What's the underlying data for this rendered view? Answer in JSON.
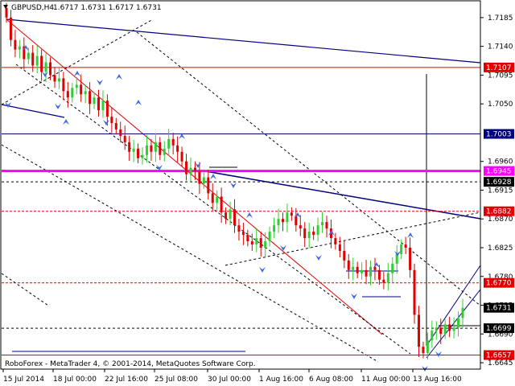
{
  "header": {
    "symbol": "GBPUSD,H4",
    "ohlc": "1.6717 1.6731 1.6717 1.6731"
  },
  "footer": {
    "copyright": "RoboForex - MetaTrader 4, © 2001-2014, MetaQuotes Software Corp."
  },
  "colors": {
    "bull": "#32cd32",
    "bear": "#e00000",
    "level_red": "#e00000",
    "level_blue": "#000080",
    "level_magenta": "#ff00ff",
    "arrow": "#4169e1",
    "grid_dark": "#000000",
    "label_red_bg": "#e00000",
    "label_blue_bg": "#000080",
    "label_magenta_bg": "#ff00ff",
    "label_current_bg": "#000000"
  },
  "chart_data": {
    "type": "candlestick",
    "title": "GBPUSD,H4",
    "x_tick_labels": [
      "15 Jul 2014",
      "18 Jul 00:00",
      "22 Jul 16:00",
      "25 Jul 08:00",
      "30 Jul 00:00",
      "1 Aug 16:00",
      "6 Aug 08:00",
      "11 Aug 00:00",
      "13 Aug 16:00"
    ],
    "y_tick_labels": [
      "1.7185",
      "1.7140",
      "1.7095",
      "1.7050",
      "1.6960",
      "1.6915",
      "1.6870",
      "1.6825",
      "1.6780",
      "1.6735",
      "1.6690",
      "1.6645"
    ],
    "ylim": [
      1.6635,
      1.721
    ],
    "price_labels": [
      {
        "value": "1.7107",
        "style": "red"
      },
      {
        "value": "1.7003",
        "style": "blue"
      },
      {
        "value": "1.6945",
        "style": "magenta"
      },
      {
        "value": "1.6928",
        "style": "black"
      },
      {
        "value": "1.6882",
        "style": "red"
      },
      {
        "value": "1.6770",
        "style": "red"
      },
      {
        "value": "1.6731",
        "style": "current"
      },
      {
        "value": "1.6699",
        "style": "black"
      },
      {
        "value": "1.6657",
        "style": "red"
      }
    ],
    "closes": [
      1.7185,
      1.715,
      1.7135,
      1.714,
      1.712,
      1.713,
      1.711,
      1.7125,
      1.71,
      1.7115,
      1.7095,
      1.7085,
      1.709,
      1.707,
      1.706,
      1.7075,
      1.708,
      1.7065,
      1.707,
      1.705,
      1.706,
      1.704,
      1.7055,
      1.703,
      1.702,
      1.701,
      1.7,
      1.699,
      1.6975,
      1.698,
      1.6965,
      1.697,
      1.6985,
      1.6975,
      1.699,
      1.697,
      1.698,
      1.6995,
      1.6985,
      1.6975,
      1.696,
      1.694,
      1.695,
      1.6945,
      1.6925,
      1.6935,
      1.691,
      1.6895,
      1.6905,
      1.688,
      1.687,
      1.6885,
      1.686,
      1.685,
      1.6845,
      1.6835,
      1.683,
      1.684,
      1.6825,
      1.6835,
      1.685,
      1.686,
      1.687,
      1.6865,
      1.688,
      1.6875,
      1.686,
      1.6855,
      1.684,
      1.685,
      1.6845,
      1.686,
      1.6865,
      1.6855,
      1.684,
      1.683,
      1.682,
      1.6805,
      1.679,
      1.6795,
      1.6785,
      1.679,
      1.678,
      1.6795,
      1.679,
      1.6775,
      1.677,
      1.6785,
      1.68,
      1.6815,
      1.683,
      1.6825,
      1.679,
      1.672,
      1.667,
      1.666,
      1.668,
      1.6695,
      1.67,
      1.669,
      1.6705,
      1.6695,
      1.67,
      1.6715,
      1.6731
    ]
  }
}
